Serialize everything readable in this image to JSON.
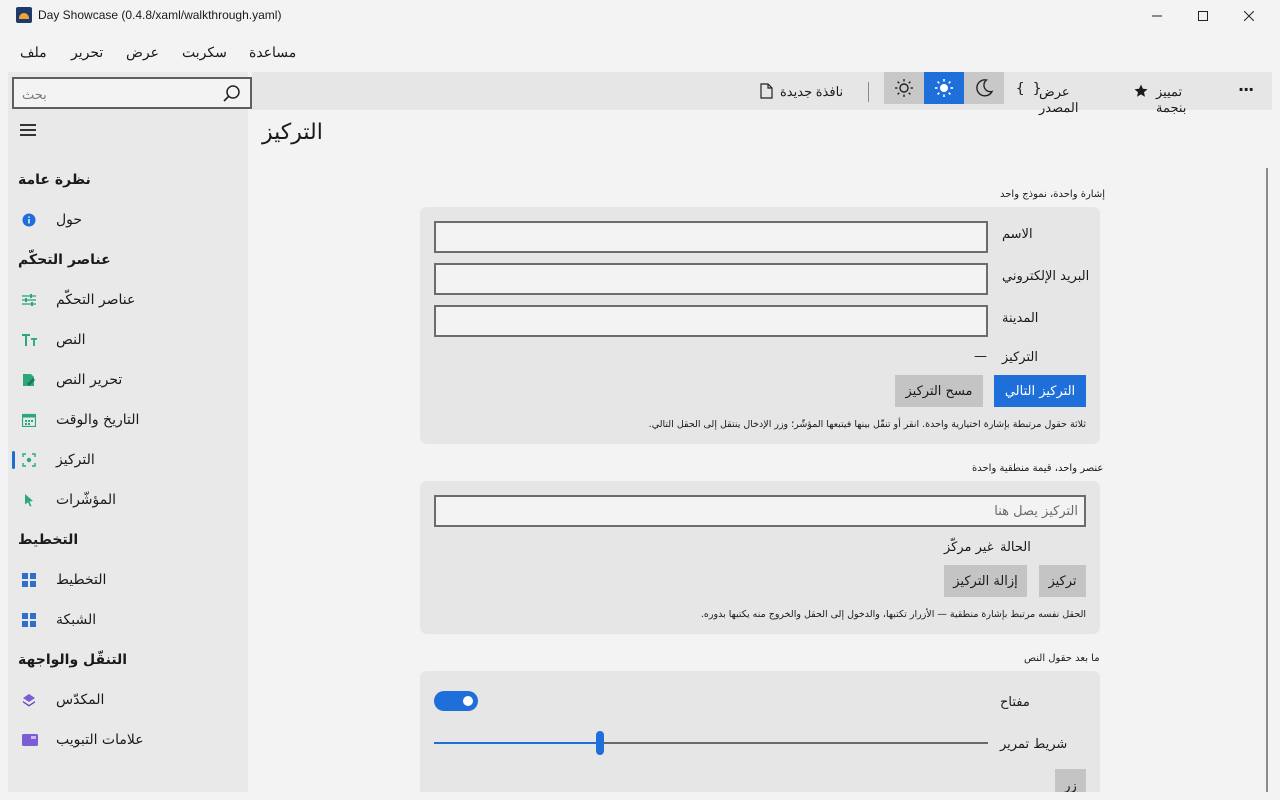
{
  "window": {
    "title": "Day Showcase (0.4.8/xaml/walkthrough.yaml)"
  },
  "menu": {
    "items": [
      "ملف",
      "تحرير",
      "عرض",
      "سكربت",
      "مساعدة"
    ]
  },
  "search": {
    "placeholder": "بحث"
  },
  "toolbar": {
    "new_window": "نافذة جديدة",
    "view_source": "عرض المصدر",
    "bookmark": "تمييز بنجمة",
    "source_glyph": "{ }",
    "more_glyph": "···"
  },
  "sidebar": {
    "sections": [
      {
        "title": "نظرة عامة",
        "items": [
          {
            "label": "حول",
            "icon": "info-icon"
          }
        ]
      },
      {
        "title": "عناصر التحكّم",
        "items": [
          {
            "label": "عناصر التحكّم",
            "icon": "sliders-icon"
          },
          {
            "label": "النص",
            "icon": "text-icon"
          },
          {
            "label": "تحرير النص",
            "icon": "edit-text-icon"
          },
          {
            "label": "التاريخ والوقت",
            "icon": "calendar-icon"
          },
          {
            "label": "التركيز",
            "icon": "focus-icon",
            "selected": true
          },
          {
            "label": "المؤشّرات",
            "icon": "cursor-icon"
          }
        ]
      },
      {
        "title": "التخطيط",
        "items": [
          {
            "label": "التخطيط",
            "icon": "layout-icon"
          },
          {
            "label": "الشبكة",
            "icon": "grid-icon"
          }
        ]
      },
      {
        "title": "التنقّل والواجهة",
        "items": [
          {
            "label": "المكدّس",
            "icon": "layers-icon"
          },
          {
            "label": "علامات التبويب",
            "icon": "tabs-icon"
          }
        ]
      }
    ]
  },
  "page": {
    "title": "التركيز",
    "group1": {
      "caption": "إشارة واحدة، نموذج واحد",
      "name_label": "الاسم",
      "email_label": "البريد الإلكتروني",
      "city_label": "المدينة",
      "focus_label": "التركيز",
      "focus_value": "—",
      "next_button": "التركيز التالي",
      "clear_button": "مسح التركيز",
      "note": "ثلاثة حقول مرتبطة بإشارة اختيارية واحدة. انقر أو تنقّل بينها فيتبعها المؤشّر؛ وزر الإدخال ينتقل إلى الحقل التالي."
    },
    "group2": {
      "caption": "عنصر واحد، قيمة منطقية واحدة",
      "placeholder": "التركيز يصل هنا",
      "state_label": "الحالة",
      "state_value": "غير مركّز",
      "focus_button": "تركيز",
      "blur_button": "إزالة التركيز",
      "note": "الحقل نفسه مرتبط بإشارة منطقية — الأزرار تكتبها، والدخول إلى الحقل والخروج منه يكتبها بدوره."
    },
    "group3": {
      "caption": "ما بعد حقول النص",
      "toggle_label": "مفتاح",
      "toggle_on": true,
      "slider_label": "شريط تمرير",
      "slider_value": 0.3,
      "button_partial": "زر"
    }
  },
  "colors": {
    "accent": "#1f6fdb",
    "sidebar_bg": "#e9e9e9",
    "card_bg": "#e6e6e6"
  }
}
